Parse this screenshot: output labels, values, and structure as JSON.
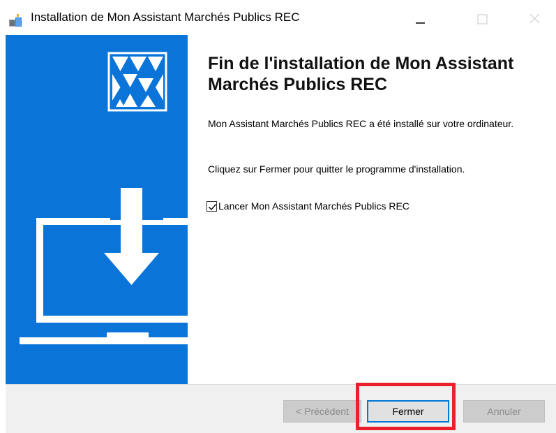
{
  "window": {
    "title": "Installation de Mon Assistant Marchés Publics REC",
    "app_icon": "installer-icon",
    "controls": {
      "minimize_icon": "minimize-icon",
      "maximize_icon": "maximize-icon",
      "close_icon": "close-icon"
    }
  },
  "banner": {
    "background_color": "#0b74d9",
    "logo_icon": "triangle-mosaic-logo",
    "illustration_icon": "laptop-download-icon"
  },
  "content": {
    "heading": "Fin de l'installation de Mon Assistant Marchés Publics REC",
    "body_installed": "Mon Assistant Marchés Publics REC a été installé sur votre ordinateur.",
    "body_instructions": "Cliquez sur Fermer pour quitter le programme d'installation.",
    "launch_checkbox": {
      "label": "Lancer Mon Assistant Marchés Publics REC",
      "checked": true
    }
  },
  "footer": {
    "prev_label": "< Précédent",
    "close_label": "Fermer",
    "cancel_label": "Annuler",
    "prev_enabled": false,
    "cancel_enabled": false
  },
  "highlight": {
    "target": "close-action-button",
    "color": "#e8212a"
  }
}
